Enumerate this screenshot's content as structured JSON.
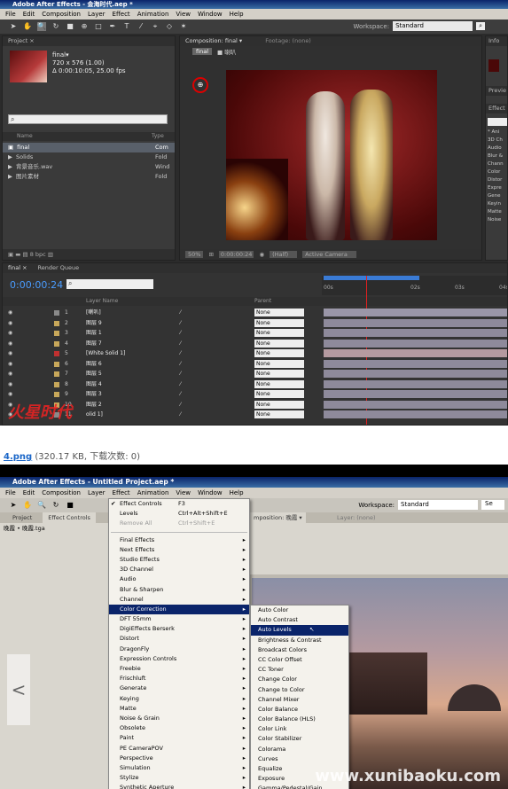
{
  "shot1": {
    "title": "Adobe After Effects - 金海时代.aep *",
    "menu": [
      "File",
      "Edit",
      "Composition",
      "Layer",
      "Effect",
      "Animation",
      "View",
      "Window",
      "Help"
    ],
    "workspace_label": "Workspace:",
    "workspace_value": "Standard",
    "project_tab": "Project ×",
    "comp_name": "final▾",
    "comp_size": "720 x 576 (1.00)",
    "comp_duration": "Δ 0:00:10:05, 25.00 fps",
    "col_name": "Name",
    "col_type": "Type",
    "project_items": [
      {
        "name": "final",
        "type": "Com"
      },
      {
        "name": "Solids",
        "type": "Fold"
      },
      {
        "name": "背景音乐.wav",
        "type": "Wind"
      },
      {
        "name": "图片素材",
        "type": "Fold"
      }
    ],
    "bpc": "8 bpc",
    "comp_tab": "Composition: final ▾",
    "footage_tab": "Footage: (none)",
    "comp_crumb_final": "final",
    "comp_crumb_sub": "■ 喇叭",
    "zoom": "50%",
    "timecode_small": "0:00:00:24",
    "resolution": "(Half)",
    "camera": "Active Camera",
    "info_tab": "Info",
    "preview_tab": "Previe",
    "effects_tab": "Effect",
    "effects_items": [
      "* Ani",
      "3D Ch",
      "Audio",
      "Blur &",
      "Chann",
      "Color",
      "Distor",
      "Expre",
      "Gene",
      "Keyin",
      "Matte",
      "Noise"
    ],
    "tl_tab_final": "final ×",
    "tl_tab_render": "Render Queue",
    "timecode": "0:00:00:24",
    "layer_name_header": "Layer Name",
    "parent_header": "Parent",
    "ruler": [
      "00s",
      "02s",
      "03s",
      "04s"
    ],
    "layers": [
      {
        "n": "1",
        "name": "[喇叭]",
        "parent": "None"
      },
      {
        "n": "2",
        "name": "图层 9",
        "parent": "None"
      },
      {
        "n": "3",
        "name": "图层 1",
        "parent": "None"
      },
      {
        "n": "4",
        "name": "图层 7",
        "parent": "None"
      },
      {
        "n": "5",
        "name": "[White Solid 1]",
        "parent": "None"
      },
      {
        "n": "6",
        "name": "图层 6",
        "parent": "None"
      },
      {
        "n": "7",
        "name": "图层 5",
        "parent": "None"
      },
      {
        "n": "8",
        "name": "图层 4",
        "parent": "None"
      },
      {
        "n": "9",
        "name": "图层 3",
        "parent": "None"
      },
      {
        "n": "10",
        "name": "图层 2",
        "parent": "None"
      },
      {
        "n": "11",
        "name": "olid 1]",
        "parent": "None"
      }
    ],
    "watermark": "火星时代"
  },
  "caption": {
    "file": "4.png",
    "meta": " (320.17 KB, 下载次数: 0)"
  },
  "shot2": {
    "title": "Adobe After Effects - Untitled Project.aep *",
    "menu": [
      "File",
      "Edit",
      "Composition",
      "Layer",
      "Effect",
      "Animation",
      "View",
      "Window",
      "Help"
    ],
    "workspace_label": "Workspace:",
    "workspace_value": "Standard",
    "search": "Se",
    "project_tab": "Project",
    "effect_controls_tab": "Effect Controls",
    "crumb": "晚霞 • 晚霞.tga",
    "comp_tab": "mposition: 晚霞 ▾",
    "layer_tab": "Layer: (none)",
    "effect_menu": [
      {
        "label": "Effect Controls",
        "sc": "F3",
        "check": true
      },
      {
        "label": "Levels",
        "sc": "Ctrl+Alt+Shift+E"
      },
      {
        "label": "Remove All",
        "sc": "Ctrl+Shift+E",
        "dis": true
      },
      {
        "sep": true
      },
      {
        "label": "Final Effects",
        "sub": true
      },
      {
        "label": "Next Effects",
        "sub": true
      },
      {
        "label": "Studio Effects",
        "sub": true
      },
      {
        "label": "3D Channel",
        "sub": true
      },
      {
        "label": "Audio",
        "sub": true
      },
      {
        "label": "Blur & Sharpen",
        "sub": true
      },
      {
        "label": "Channel",
        "sub": true
      },
      {
        "label": "Color Correction",
        "sub": true,
        "hl": true
      },
      {
        "label": "DFT 55mm",
        "sub": true
      },
      {
        "label": "DigiEffects Berserk",
        "sub": true
      },
      {
        "label": "Distort",
        "sub": true
      },
      {
        "label": "DragonFly",
        "sub": true
      },
      {
        "label": "Expression Controls",
        "sub": true
      },
      {
        "label": "Freebie",
        "sub": true
      },
      {
        "label": "Frischluft",
        "sub": true
      },
      {
        "label": "Generate",
        "sub": true
      },
      {
        "label": "Keying",
        "sub": true
      },
      {
        "label": "Matte",
        "sub": true
      },
      {
        "label": "Noise & Grain",
        "sub": true
      },
      {
        "label": "Obsolete",
        "sub": true
      },
      {
        "label": "Paint",
        "sub": true
      },
      {
        "label": "PE CameraPOV",
        "sub": true
      },
      {
        "label": "Perspective",
        "sub": true
      },
      {
        "label": "Simulation",
        "sub": true
      },
      {
        "label": "Stylize",
        "sub": true
      },
      {
        "label": "Synthetic Aperture",
        "sub": true
      }
    ],
    "color_menu": [
      {
        "label": "Auto Color"
      },
      {
        "label": "Auto Contrast"
      },
      {
        "label": "Auto Levels",
        "hl": true
      },
      {
        "label": "Brightness & Contrast"
      },
      {
        "label": "Broadcast Colors"
      },
      {
        "label": "CC Color Offset"
      },
      {
        "label": "CC Toner"
      },
      {
        "label": "Change Color"
      },
      {
        "label": "Change to Color"
      },
      {
        "label": "Channel Mixer"
      },
      {
        "label": "Color Balance"
      },
      {
        "label": "Color Balance (HLS)"
      },
      {
        "label": "Color Link"
      },
      {
        "label": "Color Stabilizer"
      },
      {
        "label": "Colorama"
      },
      {
        "label": "Curves"
      },
      {
        "label": "Equalize"
      },
      {
        "label": "Exposure"
      },
      {
        "label": "Gamma/Pedestal/Gain"
      }
    ],
    "watermark": "www.xunibaoku.com",
    "prev_arrow": "<"
  }
}
